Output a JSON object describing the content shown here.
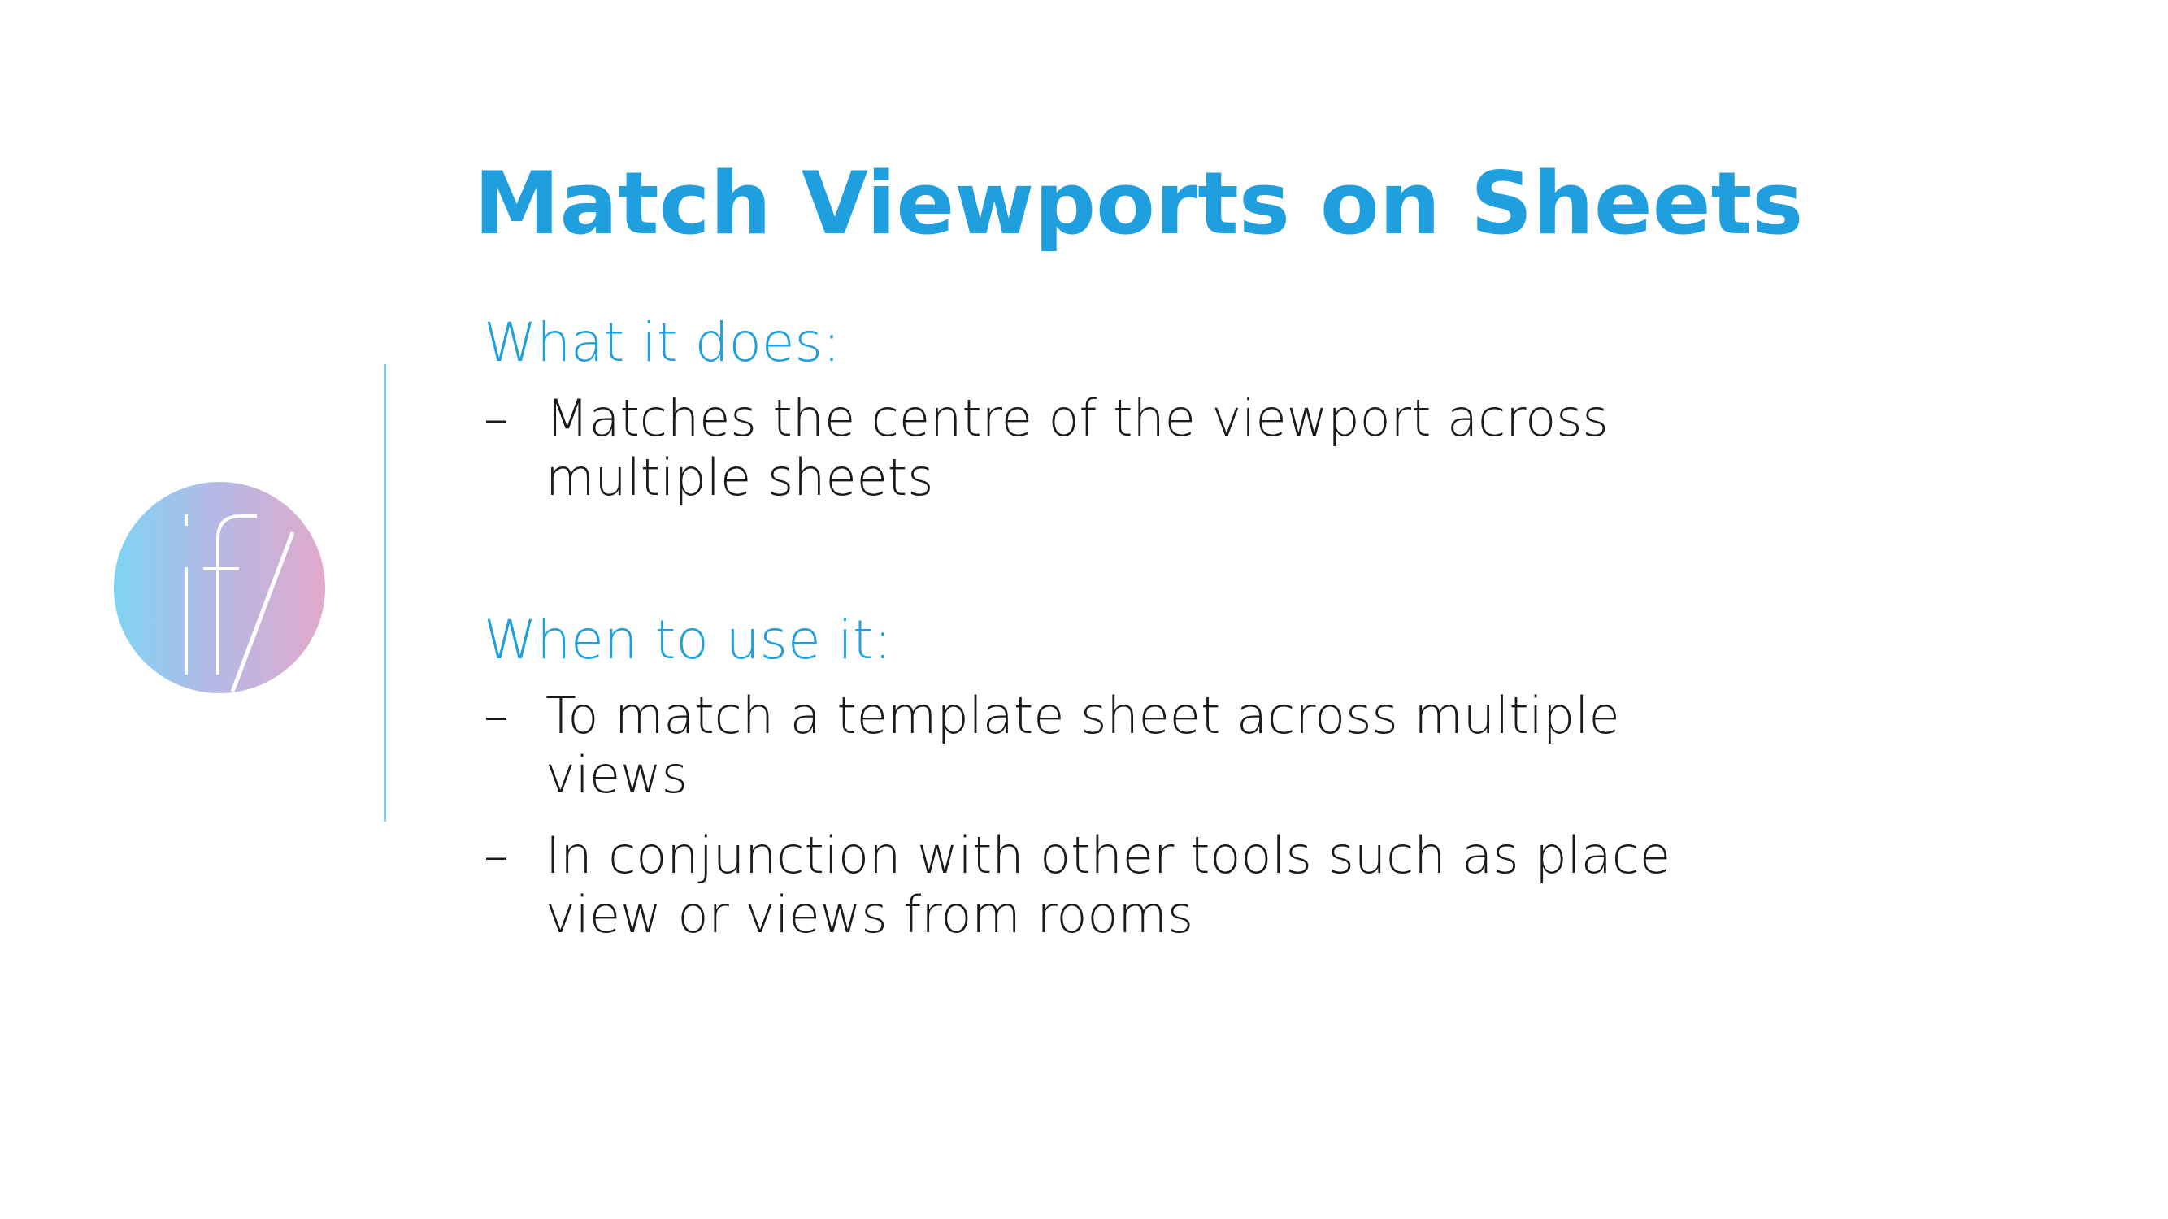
{
  "slide": {
    "title": "Match Viewports on Sheets",
    "sections": [
      {
        "heading": "What it does:",
        "bullets": [
          "Matches the centre of the viewport across multiple sheets"
        ]
      },
      {
        "heading": "When to use it:",
        "bullets": [
          "To match a template sheet across multiple views",
          "In conjunction with other tools such as place view or views from rooms"
        ]
      }
    ],
    "bullet_marker": "–"
  },
  "logo": {
    "icon": "if-logo-icon",
    "text": "if/",
    "colors": [
      "#7fd3f4",
      "#b7b8e4",
      "#e2a9cb"
    ]
  },
  "colors": {
    "accent": "#1f9fdd",
    "body_text": "#1a1a1a",
    "divider": "#8fd0ec"
  }
}
